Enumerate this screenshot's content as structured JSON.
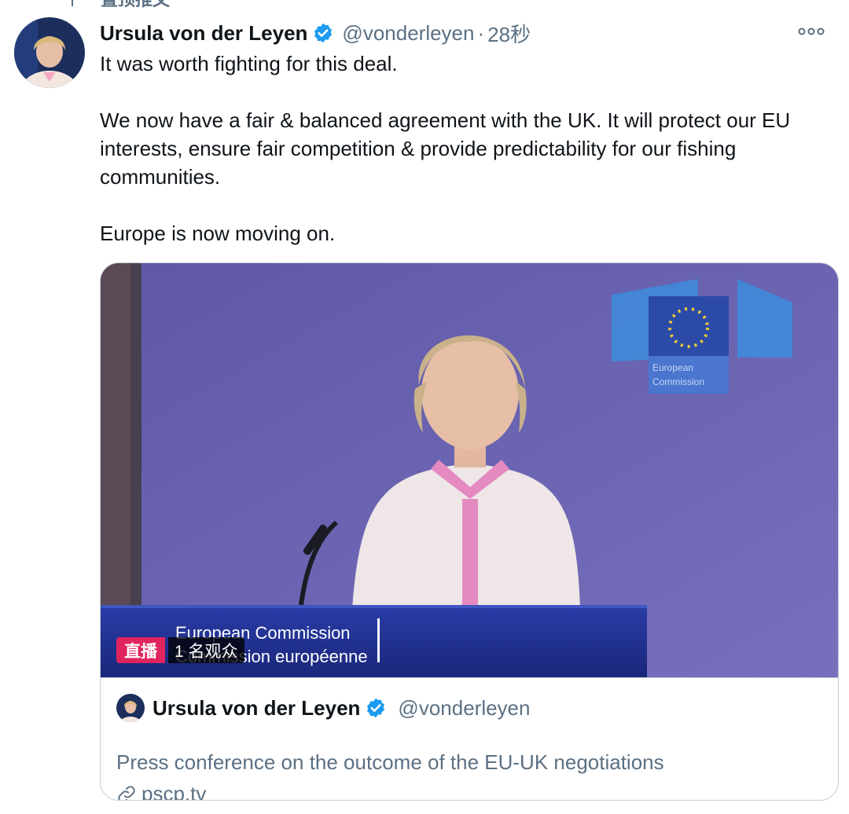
{
  "pinned": {
    "label": "置顶推文",
    "icon": "pin-icon"
  },
  "tweet": {
    "author_name": "Ursula von der Leyen",
    "handle": "@vonderleyen",
    "separator": "·",
    "time": "28秒",
    "paragraphs": [
      "It was worth fighting for this deal.",
      "We now have a fair & balanced agreement with the UK. It will protect our EU interests, ensure fair competition & provide predictability for our fishing communities.",
      "Europe is now moving on."
    ]
  },
  "card": {
    "live_label": "直播",
    "viewer_count": "1 名观众",
    "lectern_text_line1": "European Commission",
    "lectern_text_line2": "Commission européenne",
    "logo_text_line1": "European",
    "logo_text_line2": "Commission",
    "author_name": "Ursula von der Leyen",
    "handle": "@vonderleyen",
    "title": "Press conference on the outcome of the EU-UK negotiations",
    "link_text": "pscp.tv"
  },
  "colors": {
    "verified_blue": "#1d9bf0",
    "secondary_text": "#5b7083",
    "live_red": "#e0245e",
    "backdrop_purple": "#6c66b4"
  },
  "icons": [
    "pin-icon",
    "verified-icon",
    "more-icon",
    "link-icon"
  ]
}
